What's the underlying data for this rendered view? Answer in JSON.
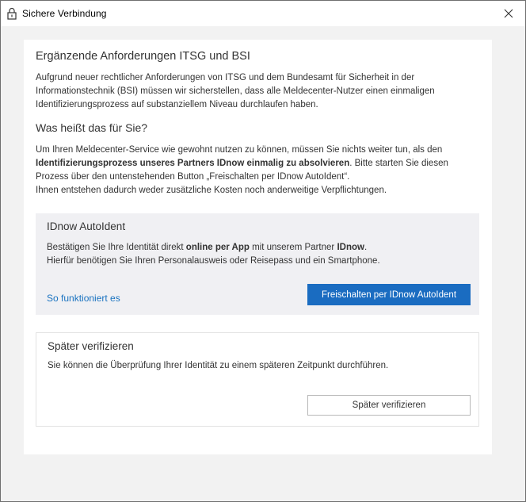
{
  "window": {
    "title": "Sichere Verbindung"
  },
  "main": {
    "heading": "Ergänzende Anforderungen ITSG und BSI",
    "intro": "Aufgrund neuer rechtlicher Anforderungen von ITSG und dem Bundesamt für Sicherheit in der Informationstechnik (BSI) müssen wir sicherstellen, dass alle Meldecenter-Nutzer einen einmaligen Identifizierungsprozess auf substanziellem Niveau durchlaufen haben.",
    "subheading": "Was heißt das für Sie?",
    "para_before": "Um Ihren Meldecenter-Service wie gewohnt nutzen zu können, müssen Sie nichts weiter tun, als den ",
    "para_bold": "Identifizierungsprozess unseres Partners IDnow einmalig zu absolvieren",
    "para_after": ". Bitte starten Sie diesen Prozess über den untenstehenden Button „Freischalten per IDnow AutoIdent“.",
    "para_line2": "Ihnen entstehen dadurch weder zusätzliche Kosten noch anderweitige Verpflichtungen."
  },
  "idnow": {
    "title": "IDnow AutoIdent",
    "text_1": "Bestätigen Sie Ihre Identität direkt ",
    "text_bold_1": "online per App",
    "text_2": " mit unserem Partner ",
    "text_bold_2": "IDnow",
    "text_3": ".",
    "text_line2": "Hierfür benötigen Sie Ihren Personalausweis oder Reisepass und ein Smartphone.",
    "link_label": "So funktioniert es",
    "button_label": "Freischalten per IDnow AutoIdent"
  },
  "later": {
    "title": "Später verifizieren",
    "text": "Sie können die Überprüfung Ihrer Identität zu einem späteren Zeitpunkt durchführen.",
    "button_label": "Später verifizieren"
  },
  "icons": {
    "lock": "lock-icon",
    "close": "close-icon"
  },
  "colors": {
    "accent": "#1a6cc1",
    "link": "#1a73c0",
    "panel": "#f0f0f3",
    "background": "#f2f2f2"
  }
}
